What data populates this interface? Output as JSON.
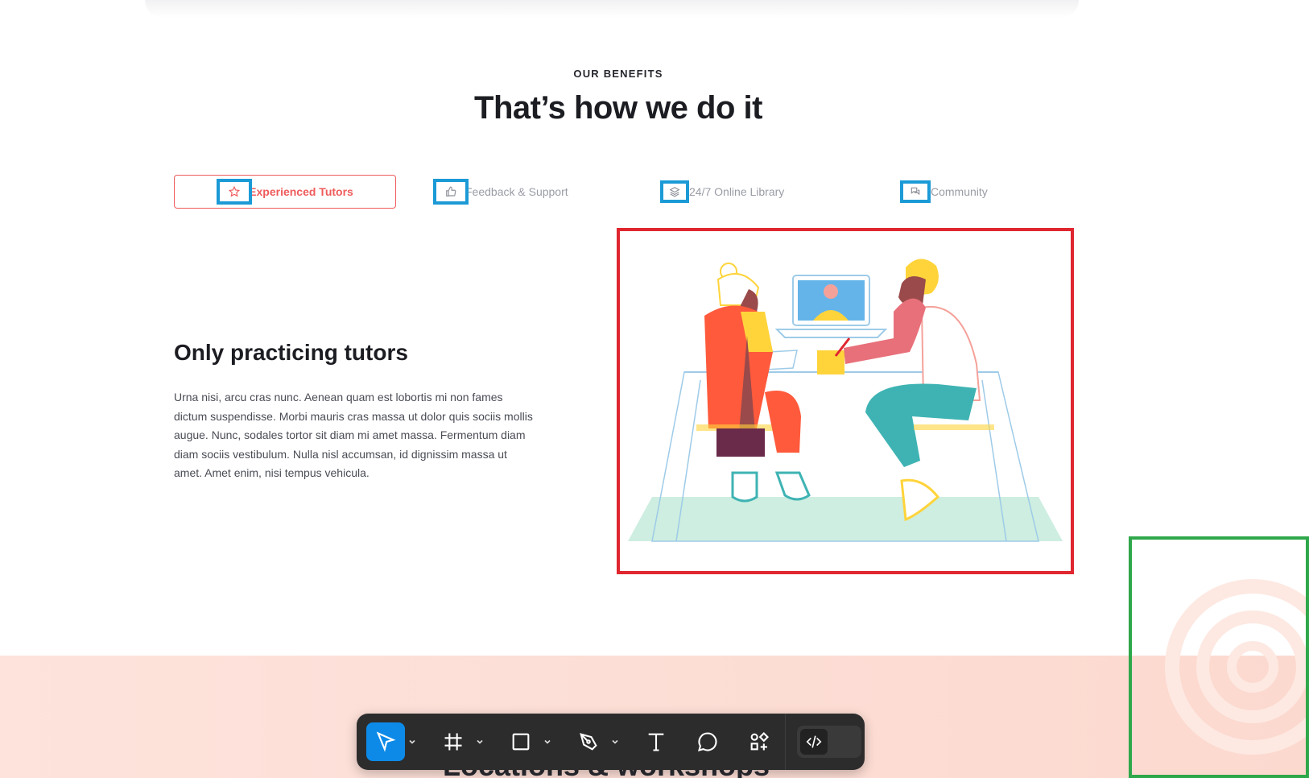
{
  "section": {
    "eyebrow": "OUR BENEFITS",
    "headline": "That’s how we do it"
  },
  "tabs": [
    {
      "label": "Experienced Tutors",
      "icon": "star-icon",
      "active": true
    },
    {
      "label": "Feedback & Support",
      "icon": "thumbs-up-icon",
      "active": false
    },
    {
      "label": "24/7 Online Library",
      "icon": "layers-icon",
      "active": false
    },
    {
      "label": "Community",
      "icon": "chat-bubbles-icon",
      "active": false
    }
  ],
  "content": {
    "title": "Only practicing tutors",
    "body": "Urna nisi, arcu cras nunc. Aenean quam est lobortis mi non fames dictum suspendisse. Morbi mauris cras massa ut dolor quis sociis mollis augue. Nunc, sodales tortor sit diam mi amet massa. Fermentum diam diam sociis vestibulum. Nulla nisl accumsan, id dignissim massa ut amet. Amet enim, nisi tempus vehicula."
  },
  "next_section": {
    "title_partial": "Locations & workshops"
  },
  "toolbar": {
    "tools": [
      "move-tool",
      "frame-tool",
      "shape-tool",
      "pen-tool",
      "text-tool",
      "comment-tool",
      "components-tool"
    ],
    "dev_mode": "dev-mode-toggle"
  },
  "colors": {
    "accent": "#ef5b5b",
    "annotation_blue": "#1b9ad6",
    "annotation_red": "#e0262f",
    "annotation_green": "#2ea84a",
    "toolbar_bg": "#2c2c2c",
    "toolbar_active": "#0d8ae8",
    "band_pink": "#fde3dc"
  }
}
